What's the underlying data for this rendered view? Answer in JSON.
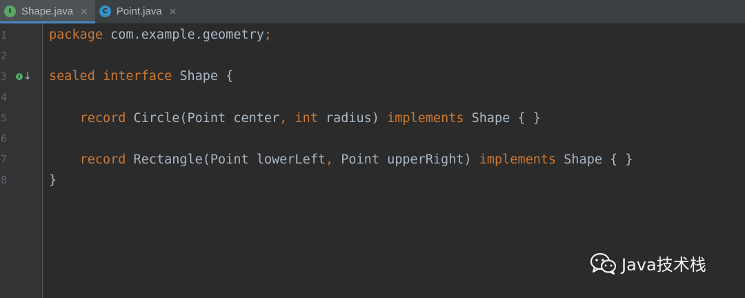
{
  "tabs": [
    {
      "label": "Shape.java",
      "icon": "interface-file-icon",
      "icon_letter": "I",
      "active": true,
      "close": "×"
    },
    {
      "label": "Point.java",
      "icon": "class-file-icon",
      "icon_letter": "C",
      "active": false,
      "close": "×"
    }
  ],
  "gutter": {
    "line_numbers": [
      "1",
      "2",
      "3",
      "4",
      "5",
      "6",
      "7",
      "8"
    ],
    "marker_icon": "implemented-by-icon",
    "marker_letter": "I",
    "marker_arrow": "↓"
  },
  "code": {
    "line1": {
      "kw1": "package",
      "t1": " com.example.geometry",
      "kw2": ";"
    },
    "line3": {
      "kw1": "sealed",
      "t1": " ",
      "kw2": "interface",
      "t2": " Shape {"
    },
    "line5": {
      "indent": "    ",
      "kw1": "record",
      "t1": " Circle(Point center",
      "kw2": ",",
      "t2": " ",
      "kw3": "int",
      "t3": " radius) ",
      "kw4": "implements",
      "t4": " Shape { }"
    },
    "line7": {
      "indent": "    ",
      "kw1": "record",
      "t1": " Rectangle(Point lowerLeft",
      "kw2": ",",
      "t2": " Point upperRight) ",
      "kw3": "implements",
      "t3": " Shape { }"
    },
    "line8": {
      "t1": "}"
    }
  },
  "watermark": {
    "icon": "wechat-icon",
    "text": "Java技术栈"
  },
  "colors": {
    "background": "#2b2b2b",
    "keyword": "#cc7832",
    "identifier": "#a9b7c6",
    "line_number": "#606366",
    "tab_active_underline": "#4a88c7"
  }
}
